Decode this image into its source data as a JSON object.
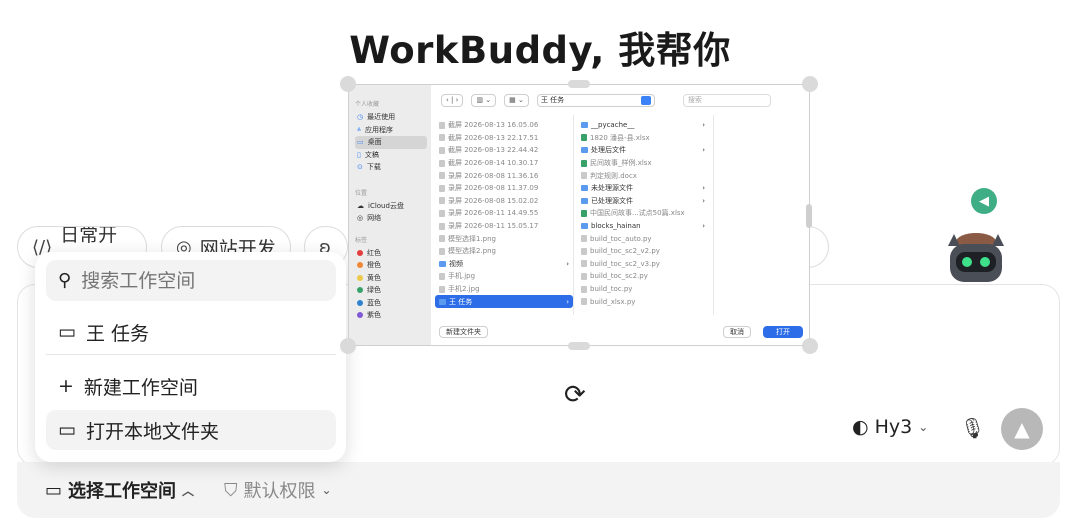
{
  "page": {
    "title": "WorkBuddy, 我帮你"
  },
  "chips": [
    {
      "label": "日常开发",
      "icon": "code-icon"
    },
    {
      "label": "网站开发",
      "icon": "globe-icon"
    }
  ],
  "workspace_menu": {
    "search_placeholder": "搜索工作空间",
    "items": [
      {
        "label": "王 任务",
        "icon": "folder-icon"
      },
      {
        "label": "新建工作空间",
        "icon": "plus-icon"
      },
      {
        "label": "打开本地文件夹",
        "icon": "folder-icon"
      }
    ]
  },
  "bottom_bar": {
    "workspace_label": "选择工作空间",
    "permission_label": "默认权限"
  },
  "composer": {
    "model_label": "Hy3"
  },
  "file_dialog": {
    "sidebar": {
      "favorites_header": "个人收藏",
      "favorites": [
        "最近使用",
        "应用程序",
        "桌面",
        "文稿",
        "下载"
      ],
      "location_header": "位置",
      "locations": [
        "iCloud云盘",
        "网络"
      ],
      "tags_header": "标签",
      "tags": [
        {
          "label": "红色",
          "color": "#e53e3e"
        },
        {
          "label": "橙色",
          "color": "#ed8936"
        },
        {
          "label": "黄色",
          "color": "#ecc94b"
        },
        {
          "label": "绿色",
          "color": "#38a169"
        },
        {
          "label": "蓝色",
          "color": "#3182ce"
        },
        {
          "label": "紫色",
          "color": "#805ad5"
        }
      ]
    },
    "toolbar": {
      "path": "王 任务",
      "search_placeholder": "搜索"
    },
    "col1": [
      "截屏 2026-08-13 16.05.06",
      "截屏 2026-08-13 22.17.51",
      "截屏 2026-08-13 22.44.42",
      "截屏 2026-08-14 10.30.17",
      "录屏 2026-08-08 11.36.16",
      "录屏 2026-08-08 11.37.09",
      "录屏 2026-08-08 15.02.02",
      "录屏 2026-08-11 14.49.55",
      "录屏 2026-08-11 15.05.17",
      "模型选择1.png",
      "模型选择2.png",
      "视频",
      "手机.jpg",
      "手机2.jpg",
      "王 任务"
    ],
    "col2": [
      "__pycache__",
      "1820 潘县-县.xlsx",
      "处理后文件",
      "民间故事_样例.xlsx",
      "判定规则.docx",
      "未处理源文件",
      "已处理源文件",
      "中国民间故事...试点50篇.xlsx",
      "blocks_hainan",
      "build_toc_auto.py",
      "build_toc_sc2_v2.py",
      "build_toc_sc2_v3.py",
      "build_toc_sc2.py",
      "build_toc.py",
      "build_xlsx.py"
    ],
    "footer": {
      "new_folder": "新建文件夹",
      "cancel": "取消",
      "open": "打开"
    }
  }
}
